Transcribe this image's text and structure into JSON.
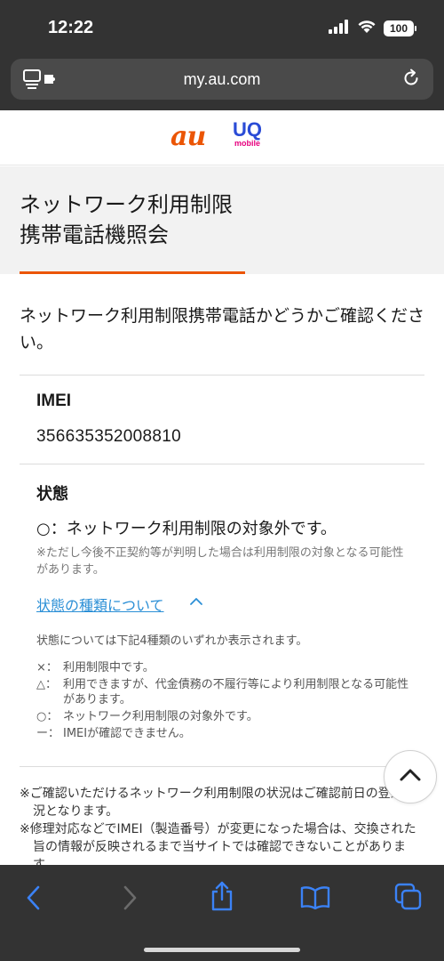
{
  "status_bar": {
    "time": "12:22",
    "battery": "100"
  },
  "browser": {
    "url": "my.au.com"
  },
  "brand": {
    "au": "au",
    "uq": "UQ",
    "uq_sub": "mobile",
    "accent": "#eb5505"
  },
  "page": {
    "title_line1": "ネットワーク利用制限",
    "title_line2": "携帯電話機照会",
    "intro": "ネットワーク利用制限携帯電話かどうかご確認ください。"
  },
  "imei": {
    "label": "IMEI",
    "value": "356635352008810"
  },
  "state": {
    "label": "状態",
    "value": "○：ネットワーク利用制限の対象外です。",
    "note": "※ただし今後不正契約等が判明した場合は利用制限の対象となる可能性があります。"
  },
  "types": {
    "link": "状態の種類について",
    "description": "状態については下記4種類のいずれか表示されます。",
    "items": [
      {
        "symbol": "×：",
        "text": "利用制限中です。"
      },
      {
        "symbol": "△：",
        "text": "利用できますが、代金債務の不履行等により利用制限となる可能性があります。"
      },
      {
        "symbol": "○：",
        "text": "ネットワーク利用制限の対象外です。"
      },
      {
        "symbol": "ー：",
        "text": "IMEIが確認できません。"
      }
    ]
  },
  "footnotes": [
    "※ご確認いただけるネットワーク利用制限の状況はご確認前日の登録状況となります。",
    "※修理対応などでIMEI（製造番号）が変更になった場合は、交換された旨の情報が反映されるまで当サイトでは確認できないことがあります。"
  ]
}
